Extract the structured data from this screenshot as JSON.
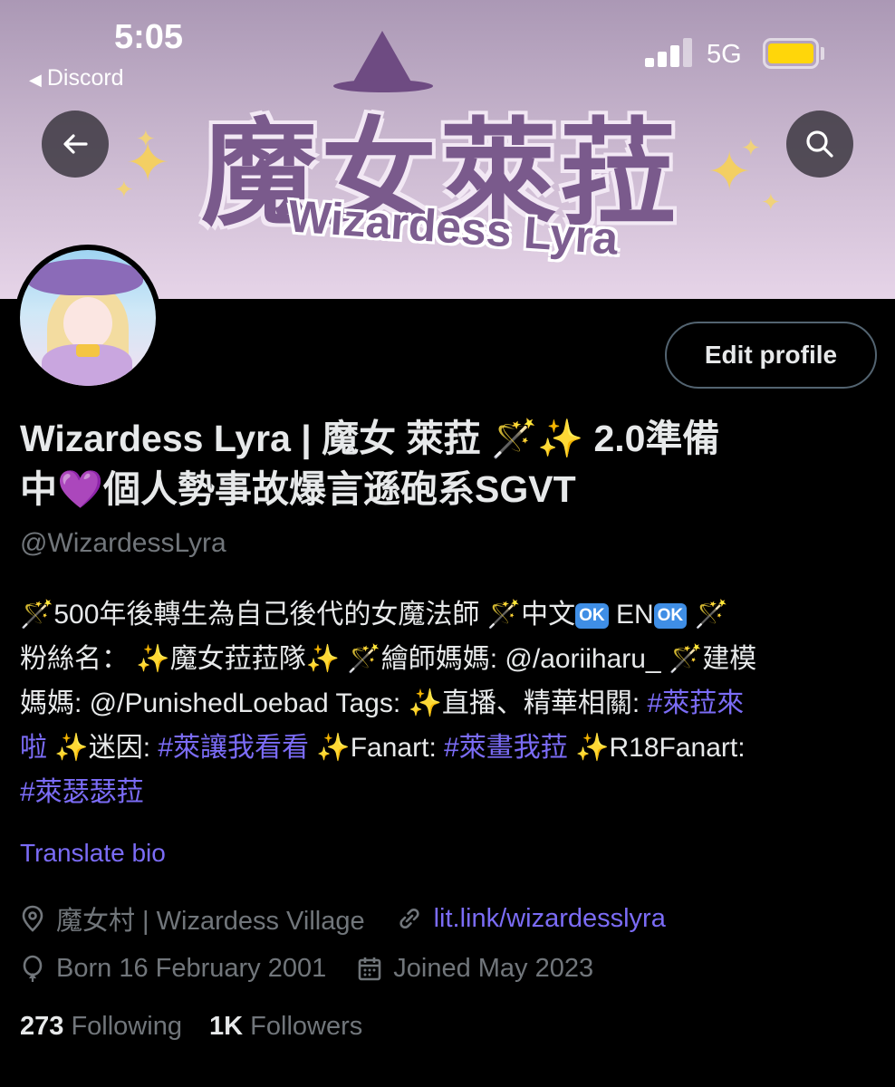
{
  "status_bar": {
    "time": "5:05",
    "back_app": "Discord",
    "network": "5G",
    "battery_color": "#ffd60a"
  },
  "banner": {
    "title_cjk": "魔女萊菈",
    "title_en": "Wizardess Lyra",
    "back_icon": "arrow-left-icon",
    "search_icon": "search-icon"
  },
  "profile": {
    "edit_button": "Edit profile",
    "name_line1": "Wizardess Lyra | 魔女 萊菈 🪄✨ 2.0準備",
    "name_line2": "中💜個人勢事故爆言遜砲系SGVT",
    "handle": "@WizardessLyra",
    "bio": {
      "line1_a": "🪄500年後轉生為自己後代的女魔法師 🪄中文",
      "ok1": "OK",
      "line1_b": " EN",
      "ok2": "OK",
      "line1_c": " 🪄",
      "line2": "粉絲名： ✨魔女菈菈隊✨ 🪄繪師媽媽: @/aoriiharu_ 🪄建模",
      "line3_a": "媽媽: @/PunishedLoebad Tags: ✨直播、精華相關: ",
      "line3_tag": "#萊菈來",
      "line4_tag_end": "啦",
      "line4_a": " ✨迷因: ",
      "line4_tag2": "#萊讓我看看",
      "line4_b": " ✨Fanart: ",
      "line4_tag3": "#萊畫我菈",
      "line4_c": " ✨R18Fanart:",
      "line5_tag": "#萊瑟瑟菈"
    },
    "translate": "Translate bio",
    "location": "魔女村 | Wizardess Village",
    "website": "lit.link/wizardesslyra",
    "birth": "Born 16 February 2001",
    "joined": "Joined May 2023",
    "following_count": "273",
    "following_label": "Following",
    "followers_count": "1K",
    "followers_label": "Followers",
    "accent_color": "#7b6cf6"
  }
}
